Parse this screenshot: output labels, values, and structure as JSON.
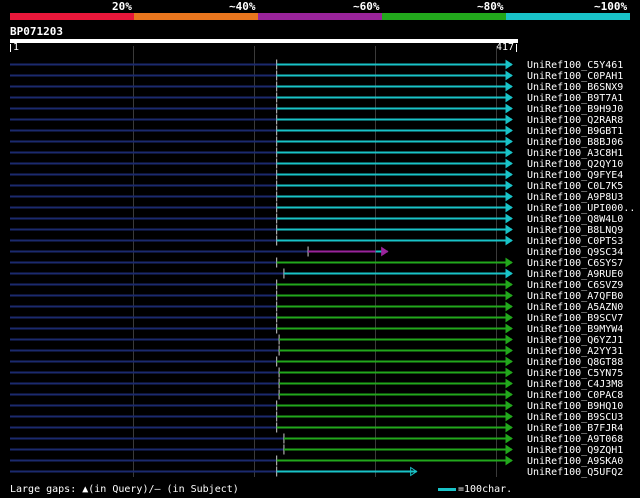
{
  "identity_legend": {
    "labels": [
      "20%",
      "~40%",
      "~60%",
      "~80%",
      "~100%"
    ],
    "colors": [
      "#e8173a",
      "#e8761e",
      "#9a249b",
      "#22a81c",
      "#19c3c8"
    ]
  },
  "query": {
    "id": "BP071203",
    "start": "1",
    "end": "417"
  },
  "hits": [
    {
      "name": "UniRef100_C5Y461",
      "start": 222,
      "end": 417,
      "color": "#19c3c8"
    },
    {
      "name": "UniRef100_C0PAH1",
      "start": 222,
      "end": 417,
      "color": "#19c3c8"
    },
    {
      "name": "UniRef100_B6SNX9",
      "start": 222,
      "end": 417,
      "color": "#19c3c8"
    },
    {
      "name": "UniRef100_B9T7A1",
      "start": 222,
      "end": 417,
      "color": "#19c3c8"
    },
    {
      "name": "UniRef100_B9H9J0",
      "start": 222,
      "end": 417,
      "color": "#19c3c8"
    },
    {
      "name": "UniRef100_Q2RAR8",
      "start": 222,
      "end": 417,
      "color": "#19c3c8"
    },
    {
      "name": "UniRef100_B9GBT1",
      "start": 222,
      "end": 417,
      "color": "#19c3c8"
    },
    {
      "name": "UniRef100_B8BJ06",
      "start": 222,
      "end": 417,
      "color": "#19c3c8"
    },
    {
      "name": "UniRef100_A3C8H1",
      "start": 222,
      "end": 417,
      "color": "#19c3c8"
    },
    {
      "name": "UniRef100_Q2QY10",
      "start": 222,
      "end": 417,
      "color": "#19c3c8"
    },
    {
      "name": "UniRef100_Q9FYE4",
      "start": 222,
      "end": 417,
      "color": "#19c3c8"
    },
    {
      "name": "UniRef100_C0L7K5",
      "start": 222,
      "end": 417,
      "color": "#19c3c8"
    },
    {
      "name": "UniRef100_A9P8U3",
      "start": 222,
      "end": 417,
      "color": "#19c3c8"
    },
    {
      "name": "UniRef100_UPI000..",
      "start": 222,
      "end": 417,
      "color": "#19c3c8"
    },
    {
      "name": "UniRef100_Q8W4L0",
      "start": 222,
      "end": 417,
      "color": "#19c3c8"
    },
    {
      "name": "UniRef100_B8LNQ9",
      "start": 222,
      "end": 417,
      "color": "#19c3c8"
    },
    {
      "name": "UniRef100_C0PTS3",
      "start": 222,
      "end": 417,
      "color": "#19c3c8"
    },
    {
      "name": "UniRef100_Q9SC34",
      "start": 248,
      "end": 304,
      "color": "#9a249b",
      "tail": 12
    },
    {
      "name": "UniRef100_C6SYS7",
      "start": 222,
      "end": 417,
      "color": "#22a81c"
    },
    {
      "name": "UniRef100_A9RUE0",
      "start": 228,
      "end": 417,
      "color": "#19c3c8"
    },
    {
      "name": "UniRef100_C6SVZ9",
      "start": 222,
      "end": 417,
      "color": "#22a81c"
    },
    {
      "name": "UniRef100_A7QFB0",
      "start": 222,
      "end": 417,
      "color": "#22a81c"
    },
    {
      "name": "UniRef100_A5AZN0",
      "start": 222,
      "end": 417,
      "color": "#22a81c"
    },
    {
      "name": "UniRef100_B9SCV7",
      "start": 222,
      "end": 417,
      "color": "#22a81c"
    },
    {
      "name": "UniRef100_B9MYW4",
      "start": 222,
      "end": 417,
      "color": "#22a81c"
    },
    {
      "name": "UniRef100_Q6YZJ1",
      "start": 224,
      "end": 417,
      "color": "#22a81c"
    },
    {
      "name": "UniRef100_A2YY31",
      "start": 224,
      "end": 417,
      "color": "#22a81c"
    },
    {
      "name": "UniRef100_Q8GT88",
      "start": 222,
      "end": 417,
      "color": "#22a81c"
    },
    {
      "name": "UniRef100_C5YN75",
      "start": 224,
      "end": 417,
      "color": "#22a81c"
    },
    {
      "name": "UniRef100_C4J3M8",
      "start": 224,
      "end": 417,
      "color": "#22a81c"
    },
    {
      "name": "UniRef100_C0PAC8",
      "start": 224,
      "end": 417,
      "color": "#22a81c"
    },
    {
      "name": "UniRef100_B9HQ10",
      "start": 222,
      "end": 417,
      "color": "#22a81c"
    },
    {
      "name": "UniRef100_B9SCU3",
      "start": 222,
      "end": 417,
      "color": "#22a81c"
    },
    {
      "name": "UniRef100_B7FJR4",
      "start": 222,
      "end": 417,
      "color": "#22a81c"
    },
    {
      "name": "UniRef100_A9T068",
      "start": 228,
      "end": 417,
      "color": "#22a81c"
    },
    {
      "name": "UniRef100_Q9ZQH1",
      "start": 228,
      "end": 417,
      "color": "#22a81c"
    },
    {
      "name": "UniRef100_A9SKA0",
      "start": 222,
      "end": 417,
      "color": "#22a81c"
    },
    {
      "name": "UniRef100_Q5UFQ2",
      "start": 222,
      "end": 338,
      "color": "#19c3c8",
      "open": true
    }
  ],
  "footer": {
    "large_gaps_text": "Large gaps: ▲(in Query)/— (in Subject)",
    "scale_text": "=100char."
  }
}
